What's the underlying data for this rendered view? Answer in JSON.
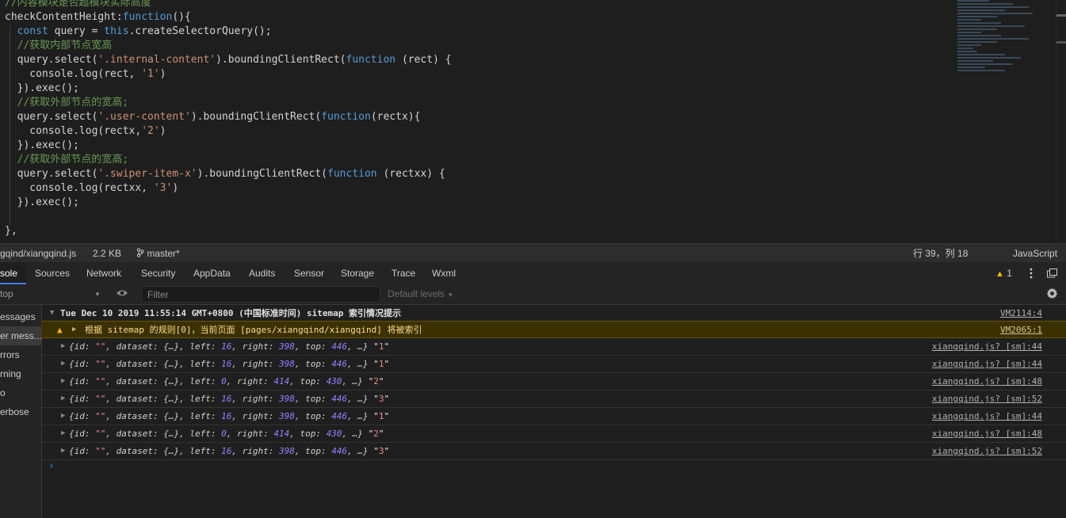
{
  "editor": {
    "lines": [
      [
        {
          "t": "//内容模块是否超模块实际高度",
          "c": "c-com"
        }
      ],
      [
        {
          "t": "checkContentHeight",
          "c": "c-plain"
        },
        {
          "t": ":",
          "c": "c-plain"
        },
        {
          "t": "function",
          "c": "c-kw"
        },
        {
          "t": "(){",
          "c": "c-plain"
        }
      ],
      [
        {
          "t": "  ",
          "c": "c-plain"
        },
        {
          "t": "const",
          "c": "c-kw"
        },
        {
          "t": " query = ",
          "c": "c-plain"
        },
        {
          "t": "this",
          "c": "c-kw"
        },
        {
          "t": ".createSelectorQuery();",
          "c": "c-plain"
        }
      ],
      [
        {
          "t": "  //获取内部节点宽高",
          "c": "c-com"
        }
      ],
      [
        {
          "t": "  query.select(",
          "c": "c-plain"
        },
        {
          "t": "'.internal-content'",
          "c": "c-str"
        },
        {
          "t": ").boundingClientRect(",
          "c": "c-plain"
        },
        {
          "t": "function",
          "c": "c-kw"
        },
        {
          "t": " (rect) {",
          "c": "c-plain"
        }
      ],
      [
        {
          "t": "    console.log(rect, ",
          "c": "c-plain"
        },
        {
          "t": "'1'",
          "c": "c-str"
        },
        {
          "t": ")",
          "c": "c-plain"
        }
      ],
      [
        {
          "t": "  }).exec();",
          "c": "c-plain"
        }
      ],
      [
        {
          "t": "  //获取外部节点的宽高;",
          "c": "c-com"
        }
      ],
      [
        {
          "t": "  query.select(",
          "c": "c-plain"
        },
        {
          "t": "'.user-content'",
          "c": "c-str"
        },
        {
          "t": ").boundingClientRect(",
          "c": "c-plain"
        },
        {
          "t": "function",
          "c": "c-kw"
        },
        {
          "t": "(rectx){",
          "c": "c-plain"
        }
      ],
      [
        {
          "t": "    console.log(rectx,",
          "c": "c-plain"
        },
        {
          "t": "'2'",
          "c": "c-str"
        },
        {
          "t": ")",
          "c": "c-plain"
        }
      ],
      [
        {
          "t": "  }).exec();",
          "c": "c-plain"
        }
      ],
      [
        {
          "t": "  //获取外部节点的宽高;",
          "c": "c-com"
        }
      ],
      [
        {
          "t": "  query.select(",
          "c": "c-plain"
        },
        {
          "t": "'.swiper-item-x'",
          "c": "c-str"
        },
        {
          "t": ").boundingClientRect(",
          "c": "c-plain"
        },
        {
          "t": "function",
          "c": "c-kw"
        },
        {
          "t": " (rectxx) {",
          "c": "c-plain"
        }
      ],
      [
        {
          "t": "    console.log(rectxx, ",
          "c": "c-plain"
        },
        {
          "t": "'3'",
          "c": "c-str"
        },
        {
          "t": ")",
          "c": "c-plain"
        }
      ],
      [
        {
          "t": "  }).exec();",
          "c": "c-plain"
        }
      ],
      [
        {
          "t": "",
          "c": "c-plain"
        }
      ],
      [
        {
          "t": "},",
          "c": "c-plain"
        }
      ]
    ]
  },
  "statusbar": {
    "file_path": "gqind/xiangqind.js",
    "file_size": "2.2 KB",
    "branch": "master*",
    "cursor": "行 39，列 18",
    "language": "JavaScript"
  },
  "devtools": {
    "tabs": [
      "sole",
      "Sources",
      "Network",
      "Security",
      "AppData",
      "Audits",
      "Sensor",
      "Storage",
      "Trace",
      "Wxml"
    ],
    "warning_count": "1",
    "context": "top",
    "filter_placeholder": "Filter",
    "levels": "Default levels",
    "sidebar": [
      "essages",
      "er mess...",
      "rrors",
      "rning",
      "o",
      "erbose"
    ],
    "header": {
      "text": "Tue Dec 10 2019 11:55:14 GMT+0800 (中国标准时间) sitemap 索引情况提示",
      "source": "VM2114:4"
    },
    "warning": {
      "text": "根据 sitemap 的规则[0]，当前页面 [pages/xiangqind/xiangqind] 将被索引",
      "source": "VM2065:1"
    },
    "logs": [
      {
        "left": "16",
        "right": "398",
        "top": "446",
        "label": "1",
        "source": "xiangqind.js? [sm]:44"
      },
      {
        "left": "16",
        "right": "398",
        "top": "446",
        "label": "1",
        "source": "xiangqind.js? [sm]:44"
      },
      {
        "left": "0",
        "right": "414",
        "top": "430",
        "label": "2",
        "source": "xiangqind.js? [sm]:48"
      },
      {
        "left": "16",
        "right": "398",
        "top": "446",
        "label": "3",
        "source": "xiangqind.js? [sm]:52"
      },
      {
        "left": "16",
        "right": "398",
        "top": "446",
        "label": "1",
        "source": "xiangqind.js? [sm]:44"
      },
      {
        "left": "0",
        "right": "414",
        "top": "430",
        "label": "2",
        "source": "xiangqind.js? [sm]:48"
      },
      {
        "left": "16",
        "right": "398",
        "top": "446",
        "label": "3",
        "source": "xiangqind.js? [sm]:52"
      }
    ],
    "log_strings": {
      "open": "{id: ",
      "id_value": "\"\"",
      "dataset": ", dataset: ",
      "dataset_value": "{…}",
      "left_key": ", left: ",
      "right_key": ", right: ",
      "top_key": ", top: ",
      "close": ", …} "
    }
  }
}
